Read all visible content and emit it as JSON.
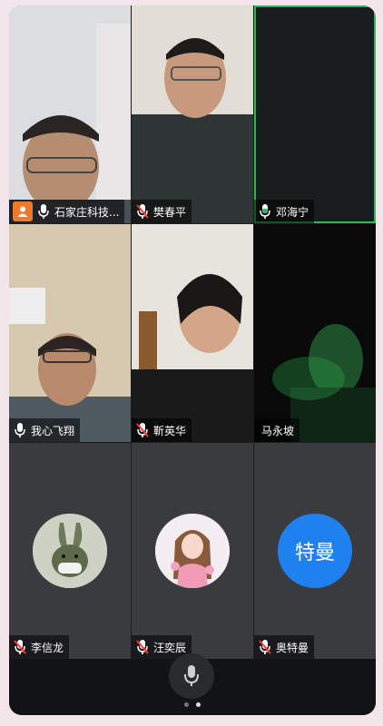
{
  "participants": [
    {
      "name": "石家庄科技...",
      "host": true
    },
    {
      "name": "樊春平"
    },
    {
      "name": "邓海宁",
      "speaking": true
    },
    {
      "name": "我心飞翔"
    },
    {
      "name": "靳英华"
    },
    {
      "name": "马永坡"
    },
    {
      "name": "李信龙"
    },
    {
      "name": "汪奕辰"
    },
    {
      "name": "奥特曼",
      "avatar_text": "特曼"
    }
  ],
  "colors": {
    "speaking_border": "#2fb85a",
    "host_badge": "#f07a2a",
    "avatar_blue": "#1f80f0"
  },
  "pager": {
    "pages": 2,
    "current": 2
  }
}
